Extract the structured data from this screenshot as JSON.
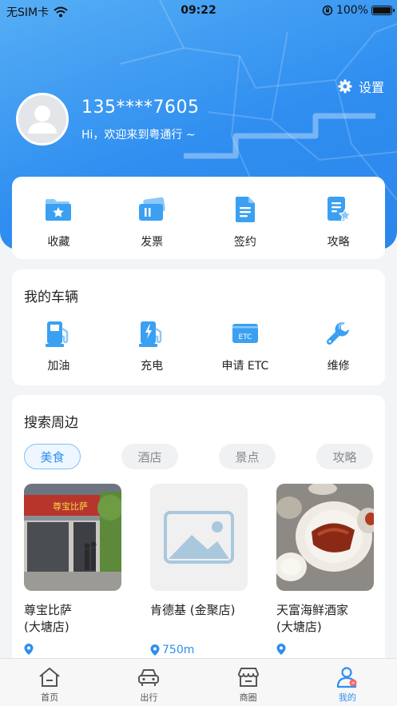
{
  "status_bar": {
    "carrier": "无SIM卡",
    "time": "09:22",
    "battery": "100%"
  },
  "header": {
    "settings_label": "设置",
    "phone": "135****7605",
    "welcome": "Hi，欢迎来到粤通行 ~"
  },
  "quick_actions": [
    {
      "label": "收藏",
      "icon": "folder-star-icon"
    },
    {
      "label": "发票",
      "icon": "invoice-icon"
    },
    {
      "label": "签约",
      "icon": "document-icon"
    },
    {
      "label": "攻略",
      "icon": "guide-icon"
    }
  ],
  "vehicles": {
    "title": "我的车辆",
    "items": [
      {
        "label": "加油",
        "icon": "fuel-pump-icon"
      },
      {
        "label": "充电",
        "icon": "charging-station-icon"
      },
      {
        "label": "申请 ETC",
        "icon": "etc-card-icon",
        "badge": "ETC"
      },
      {
        "label": "维修",
        "icon": "wrench-icon"
      }
    ]
  },
  "nearby": {
    "title": "搜索周边",
    "tabs": [
      "美食",
      "酒店",
      "景点",
      "攻略"
    ],
    "places": [
      {
        "name": "尊宝比萨\n(大塘店)",
        "distance": "",
        "sign_text": "尊宝比萨"
      },
      {
        "name": "肯德基 (金聚店)",
        "distance": "750m"
      },
      {
        "name": "天富海鲜酒家\n(大塘店)",
        "distance": ""
      }
    ]
  },
  "tabbar": [
    {
      "label": "首页",
      "icon": "home-icon"
    },
    {
      "label": "出行",
      "icon": "car-icon"
    },
    {
      "label": "商圈",
      "icon": "store-icon"
    },
    {
      "label": "我的",
      "icon": "user-icon"
    }
  ],
  "colors": {
    "primary": "#2f8ef0",
    "icon_blue": "#3ba0f2"
  }
}
